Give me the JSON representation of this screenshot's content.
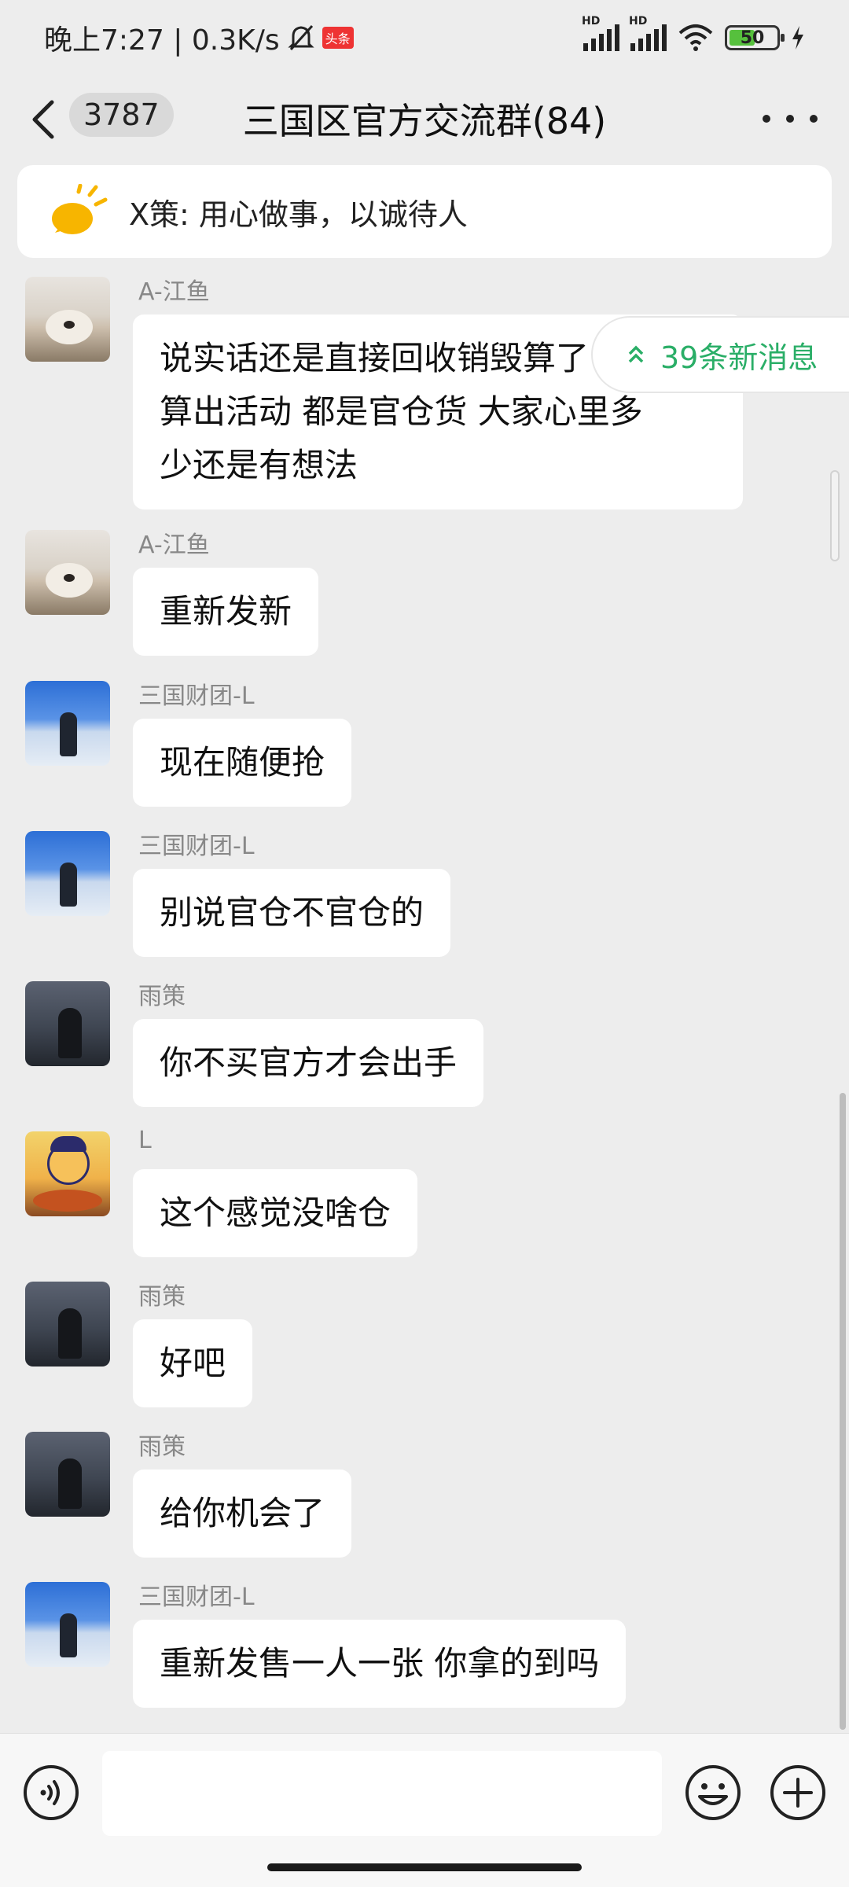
{
  "status_bar": {
    "time_speed": "晚上7:27 | 0.3K/s",
    "app_badge": "头条",
    "network_hd_1": "HD",
    "network_hd_2": "HD",
    "battery": "50"
  },
  "header": {
    "unread_count": "3787",
    "title": "三国区官方交流群(84)"
  },
  "notice": {
    "text": "X策: 用心做事，以诚待人"
  },
  "new_messages_label": "39条新消息",
  "messages": [
    {
      "sender": "A-江鱼",
      "lines": [
        "说实话还是直接回收销毁算了",
        "算出活动 都是官仓货  大家心里多",
        "少还是有想法"
      ],
      "avatar": "dog-avatar"
    },
    {
      "sender": "A-江鱼",
      "lines": [
        "重新发新"
      ],
      "avatar": "dog-avatar"
    },
    {
      "sender": "三国财团-L",
      "lines": [
        "现在随便抢"
      ],
      "avatar": "sky-person-avatar"
    },
    {
      "sender": "三国财团-L",
      "lines": [
        "别说官仓不官仓的"
      ],
      "avatar": "sky-person-avatar"
    },
    {
      "sender": "雨策",
      "lines": [
        "你不买官方才会出手"
      ],
      "avatar": "dark-sky-avatar"
    },
    {
      "sender": "L",
      "lines": [
        "这个感觉没啥仓"
      ],
      "avatar": "cartoon-avatar"
    },
    {
      "sender": "雨策",
      "lines": [
        "好吧"
      ],
      "avatar": "dark-sky-avatar"
    },
    {
      "sender": "雨策",
      "lines": [
        "给你机会了"
      ],
      "avatar": "dark-sky-avatar"
    },
    {
      "sender": "三国财团-L",
      "lines": [
        "重新发售一人一张 你拿的到吗"
      ],
      "avatar": "sky-person-avatar"
    }
  ],
  "input": {
    "placeholder": ""
  },
  "icons": {
    "back": "back-chevron-icon",
    "more": "more-dots-icon",
    "notice": "announcement-sun-icon",
    "voice": "voice-icon",
    "emoji": "emoji-icon",
    "plus": "plus-icon"
  }
}
